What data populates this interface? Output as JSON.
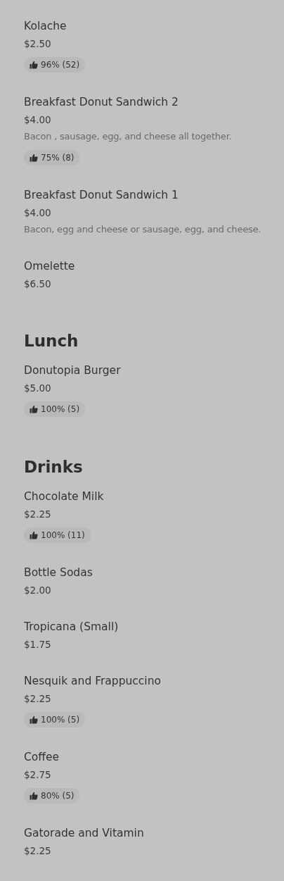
{
  "sections": [
    {
      "items": [
        {
          "name": "Kolache",
          "price": "$2.50",
          "rating": "96% (52)"
        },
        {
          "name": "Breakfast Donut Sandwich 2",
          "price": "$4.00",
          "description": "Bacon , sausage, egg, and cheese all together.",
          "rating": "75% (8)"
        },
        {
          "name": "Breakfast Donut Sandwich 1",
          "price": "$4.00",
          "description": "Bacon, egg and cheese or sausage, egg, and cheese."
        },
        {
          "name": "Omelette",
          "price": "$6.50"
        }
      ]
    },
    {
      "title": "Lunch",
      "items": [
        {
          "name": "Donutopia Burger",
          "price": "$5.00",
          "rating": "100% (5)"
        }
      ]
    },
    {
      "title": "Drinks",
      "items": [
        {
          "name": "Chocolate Milk",
          "price": "$2.25",
          "rating": "100% (11)"
        },
        {
          "name": "Bottle Sodas",
          "price": "$2.00"
        },
        {
          "name": "Tropicana (Small)",
          "price": "$1.75"
        },
        {
          "name": "Nesquik and Frappuccino",
          "price": "$2.25",
          "rating": "100% (5)"
        },
        {
          "name": "Coffee",
          "price": "$2.75",
          "rating": "80% (5)"
        },
        {
          "name": "Gatorade and Vitamin",
          "price": "$2.25"
        }
      ]
    }
  ]
}
